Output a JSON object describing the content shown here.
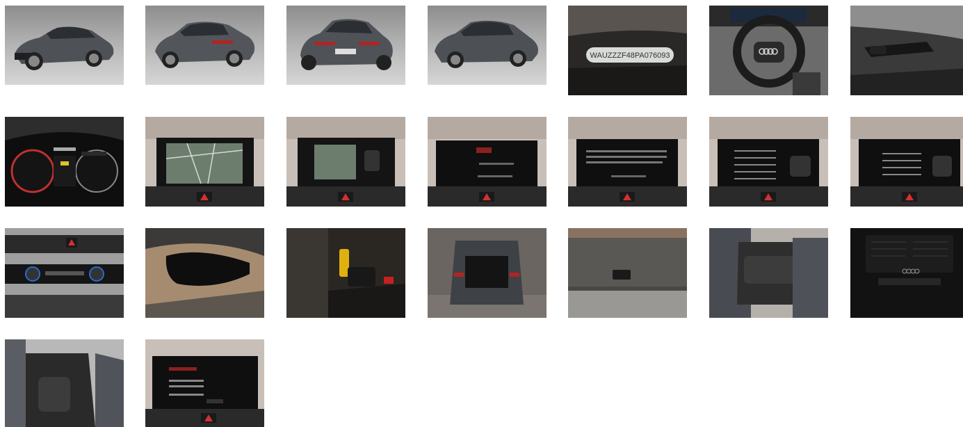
{
  "gallery": {
    "vin_label": "WAUZZZF48PA076093",
    "photos": [
      {
        "subject": "car-front-three-quarter",
        "icon": "car-photo-icon"
      },
      {
        "subject": "car-rear-three-quarter",
        "icon": "car-photo-icon"
      },
      {
        "subject": "car-rear",
        "icon": "car-photo-icon"
      },
      {
        "subject": "car-front-side",
        "icon": "car-photo-icon"
      },
      {
        "subject": "vin-plate",
        "icon": "vin-plate-icon"
      },
      {
        "subject": "steering-wheel",
        "icon": "steering-wheel-icon"
      },
      {
        "subject": "wiper-stalk",
        "icon": "stalk-icon"
      },
      {
        "subject": "instrument-cluster",
        "icon": "cluster-icon"
      },
      {
        "subject": "navigation-map",
        "icon": "screen-icon"
      },
      {
        "subject": "navigation-map-2",
        "icon": "screen-icon"
      },
      {
        "subject": "screen-menu",
        "icon": "screen-icon"
      },
      {
        "subject": "screen-message",
        "icon": "screen-icon"
      },
      {
        "subject": "assist-settings",
        "icon": "screen-icon"
      },
      {
        "subject": "assist-settings-2",
        "icon": "screen-icon"
      },
      {
        "subject": "climate-controls",
        "icon": "climate-icon"
      },
      {
        "subject": "rear-view-mirror",
        "icon": "mirror-icon"
      },
      {
        "subject": "key-and-console",
        "icon": "key-icon"
      },
      {
        "subject": "open-trunk",
        "icon": "trunk-icon"
      },
      {
        "subject": "tailgate-button",
        "icon": "tailgate-icon"
      },
      {
        "subject": "rear-seats",
        "icon": "seat-icon"
      },
      {
        "subject": "rear-vents",
        "icon": "vent-icon"
      },
      {
        "subject": "front-seats",
        "icon": "seat-icon"
      },
      {
        "subject": "service-screen",
        "icon": "screen-icon"
      }
    ]
  }
}
